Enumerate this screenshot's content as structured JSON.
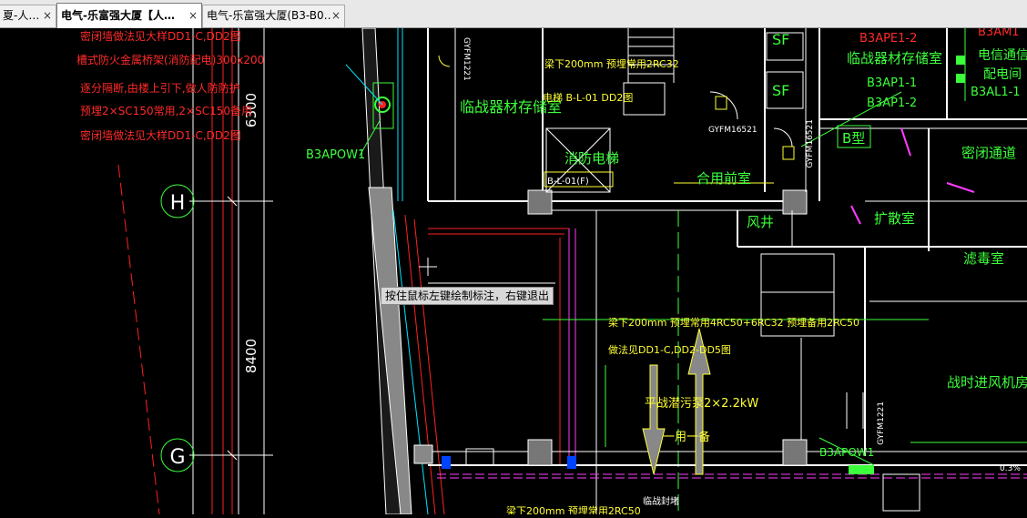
{
  "tabs": [
    {
      "label": "夏-人…",
      "close": "×",
      "active": false
    },
    {
      "label": "电气-乐富强大厦【人…",
      "close": "×",
      "active": true
    },
    {
      "label": "电气-乐富强大厦(B3-B0…",
      "close": "×",
      "active": false
    }
  ],
  "tooltip": "按住鼠标左键绘制标注，右键退出",
  "notes_red": [
    "密闭墙做法见大样DD1-C,DD2图",
    "槽式防火金属桥架(消防配电)300x200",
    "逐分隔断,由楼上引下,做人防防护",
    "预埋2×SC150常用,2×SC150备用",
    "密闭墙做法见大样DD1-C,DD2图"
  ],
  "axis": {
    "h": "H",
    "g": "G"
  },
  "dims": {
    "upper": "6300",
    "lower": "8400"
  },
  "labels": {
    "b3apow1_left": "B3APOW1",
    "gyfm1221_top": "GYFM1221",
    "storage_left": "临战器材存储室",
    "beam_note_top": "梁下200mm 预埋常用2RC32",
    "elev_box_label": "电梯 B-L-01 DD2图",
    "fire_elevator": "消防电梯",
    "elev_tag": "B-L-01(F)",
    "sf1": "SF",
    "sf2": "SF",
    "gyfm16521a": "GYFM16521",
    "gyfm16521b": "GYFM16521",
    "b_type": "B型",
    "combined_lobby": "合用前室",
    "air_shaft": "风井",
    "expansion_room": "扩散室",
    "sealed_passage": "密闭通道",
    "filter_room": "滤毒室",
    "storage_right": "临战器材存储室",
    "b3ape1_2": "B3APE1-2",
    "b3ap1_1": "B3AP1-1",
    "b3ap1_2": "B3AP1-2",
    "b3am": "B3AM1",
    "b3al1_1": "B3AL1-1",
    "comm_room": "电信通信",
    "power_room": "配电间",
    "beam_note_mid": "梁下200mm 预埋常用4RC50+6RC32 预埋备用2RC50",
    "method_note": "做法见DD1-C,DD2-DD5图",
    "pump_note": "平战潜污泵2×2.2kW",
    "duty": "一用一备",
    "wartime_fan_room": "战时进风机房",
    "gyfm1221_right": "GYFM1221",
    "b3apow1_right": "B3APOW1",
    "slope": "0.3%",
    "beam_note_bottom": "梁下200mm 预埋常用2RC50",
    "fire_vehicle": "临战封堵"
  },
  "colors": {
    "bg": "#000000",
    "wall": "#ffffff",
    "note_red": "#ff2a2a",
    "room_green": "#3cff3c",
    "label_yellow": "#ffff33",
    "cyan": "#00e5ff",
    "magenta": "#ff3cff",
    "grid_red": "#ff2020"
  }
}
